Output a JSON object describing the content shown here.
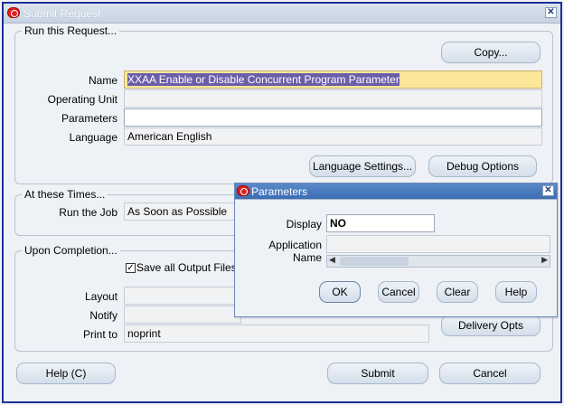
{
  "submit_window": {
    "title": "Submit Request",
    "run_group": {
      "label": "Run this Request...",
      "copy_button": "Copy...",
      "name_label": "Name",
      "name_value": "XXAA Enable or Disable Concurrent Program Parameter",
      "operating_unit_label": "Operating Unit",
      "operating_unit_value": "",
      "parameters_label": "Parameters",
      "parameters_value": "",
      "language_label": "Language",
      "language_value": "American English",
      "language_settings_button": "Language Settings...",
      "debug_options_button": "Debug Options"
    },
    "times_group": {
      "label": "At these Times...",
      "run_job_label": "Run the Job",
      "run_job_value": "As Soon as Possible"
    },
    "completion_group": {
      "label": "Upon Completion...",
      "save_output_label": "Save all Output Files",
      "save_output_checked": true,
      "layout_label": "Layout",
      "notify_label": "Notify",
      "print_to_label": "Print to",
      "print_to_value": "noprint",
      "delivery_opts_button": "Delivery Opts"
    },
    "help_button": "Help (C)",
    "submit_button": "Submit",
    "cancel_button": "Cancel"
  },
  "parameters_window": {
    "title": "Parameters",
    "display_label": "Display",
    "display_value": "NO",
    "application_name_label": "Application Name",
    "application_name_value": "",
    "ok_button": "OK",
    "cancel_button": "Cancel",
    "clear_button": "Clear",
    "help_button": "Help"
  }
}
